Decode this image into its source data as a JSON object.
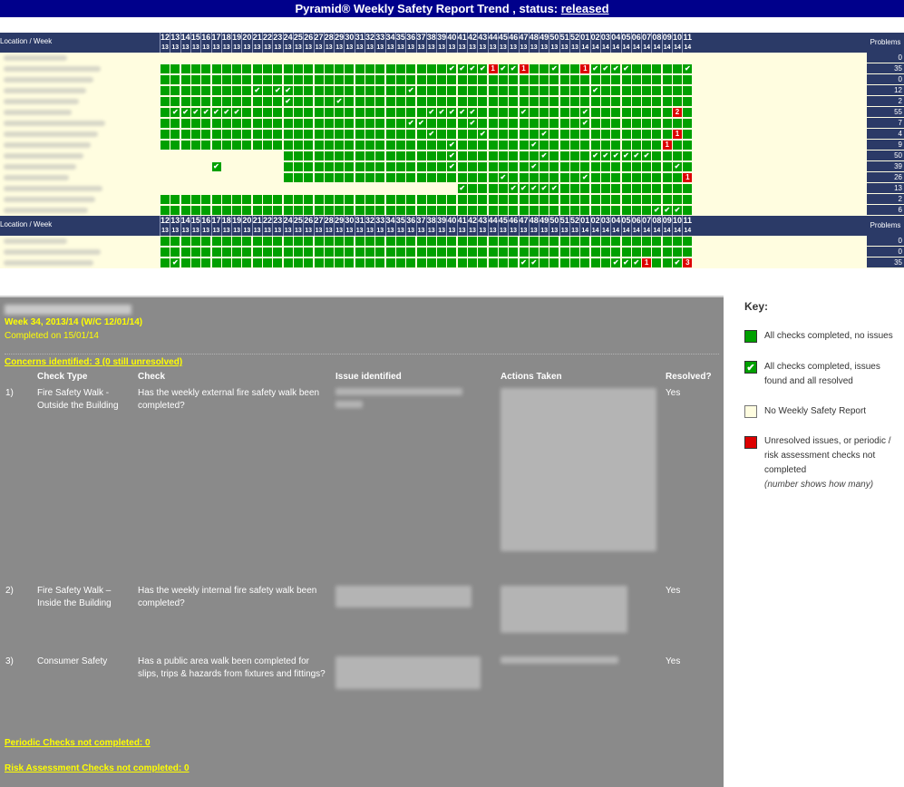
{
  "title": {
    "prefix": "Pyramid® Weekly Safety Report Trend , status: ",
    "status": "released"
  },
  "grid": {
    "header_label": "Location  /  Week",
    "problems_label": "Problems",
    "weeks": [
      {
        "w": "12",
        "y": "13"
      },
      {
        "w": "13",
        "y": "13"
      },
      {
        "w": "14",
        "y": "13"
      },
      {
        "w": "15",
        "y": "13"
      },
      {
        "w": "16",
        "y": "13"
      },
      {
        "w": "17",
        "y": "13"
      },
      {
        "w": "18",
        "y": "13"
      },
      {
        "w": "19",
        "y": "13"
      },
      {
        "w": "20",
        "y": "13"
      },
      {
        "w": "21",
        "y": "13"
      },
      {
        "w": "22",
        "y": "13"
      },
      {
        "w": "23",
        "y": "13"
      },
      {
        "w": "24",
        "y": "13"
      },
      {
        "w": "25",
        "y": "13"
      },
      {
        "w": "26",
        "y": "13"
      },
      {
        "w": "27",
        "y": "13"
      },
      {
        "w": "28",
        "y": "13"
      },
      {
        "w": "29",
        "y": "13"
      },
      {
        "w": "30",
        "y": "13"
      },
      {
        "w": "31",
        "y": "13"
      },
      {
        "w": "32",
        "y": "13"
      },
      {
        "w": "33",
        "y": "13"
      },
      {
        "w": "34",
        "y": "13"
      },
      {
        "w": "35",
        "y": "13"
      },
      {
        "w": "36",
        "y": "13"
      },
      {
        "w": "37",
        "y": "13"
      },
      {
        "w": "38",
        "y": "13"
      },
      {
        "w": "39",
        "y": "13"
      },
      {
        "w": "40",
        "y": "13"
      },
      {
        "w": "41",
        "y": "13"
      },
      {
        "w": "42",
        "y": "13"
      },
      {
        "w": "43",
        "y": "13"
      },
      {
        "w": "44",
        "y": "13"
      },
      {
        "w": "45",
        "y": "13"
      },
      {
        "w": "46",
        "y": "13"
      },
      {
        "w": "47",
        "y": "13"
      },
      {
        "w": "48",
        "y": "13"
      },
      {
        "w": "49",
        "y": "13"
      },
      {
        "w": "50",
        "y": "13"
      },
      {
        "w": "51",
        "y": "13"
      },
      {
        "w": "52",
        "y": "13"
      },
      {
        "w": "01",
        "y": "14"
      },
      {
        "w": "02",
        "y": "14"
      },
      {
        "w": "03",
        "y": "14"
      },
      {
        "w": "04",
        "y": "14"
      },
      {
        "w": "05",
        "y": "14"
      },
      {
        "w": "06",
        "y": "14"
      },
      {
        "w": "07",
        "y": "14"
      },
      {
        "w": "08",
        "y": "14"
      },
      {
        "w": "09",
        "y": "14"
      },
      {
        "w": "10",
        "y": "14"
      },
      {
        "w": "11",
        "y": "14"
      }
    ],
    "sections": [
      {
        "rows": [
          {
            "cells": "                                    ",
            "problems": "0"
          },
          {
            "cells": "GGGGGGGGGGGGGGGGGGGGGGGGGGGGCCCCR1CCR1GGCGGR1CCCCGGGGGCCCGR1R1CG",
            "problems": "35"
          },
          {
            "cells": "GGGGGGGGGGGGGGGGGGGGGGGGGGGGGGGGGGGGGGGGGGGGGGGGGGGG",
            "problems": "0"
          },
          {
            "cells": "GGGGGGGGGCGCCGGGGGGGGGGGCGGGGGGGGGGGGGGGGGCGGGGGGGGGGGGGGGGGGCGG",
            "problems": "12"
          },
          {
            "cells": "GGGGGGGGGGGGCGGGGCGGGGGGGGGGGGGGGGGGGGGGGGGGGGGGGGGG",
            "problems": "2"
          },
          {
            "cells": "GCCCCCCCGGGGGGGGGGGGGGGGGGCCCCCGGGGCGGGGGCGGGGGGGGR2GGGGR1",
            "problems": "55"
          },
          {
            "cells": "GGGGGGGGGGGGGGGGGGGGGGGGCCGGGGCGGGGGGGGGGCGGGGGGGGGGGGGGGR1GG",
            "problems": "7"
          },
          {
            "cells": "GGGGGGGGGGGGGGGGGGGGGGGGGGCGGGGCGGGGGCGGGGGGGGGGGGR1GGGGGGGGGGG",
            "problems": "4"
          },
          {
            "cells": "GGGGGGGGGGGGGGGGGGGGGGGGGGGGCGGGGGGGCGGGGGGGGGGGGR1GGGGGGGGGGG",
            "problems": "9"
          },
          {
            "cells": "____________GGGGGGGGGGGGGGGGCGGGGGGGGCGGGGCCCCCCGGGGGR2R1GGR1R1",
            "problems": "50"
          },
          {
            "cells": "_____C______GGGGGGGGGGGGGGGGCGGGGGGGCGGGGGGGGGGGGGCGGGCGGR5GR2C",
            "problems": "39"
          },
          {
            "cells": "____________GGGGGGGGGGGGGGGGGGGGGCGGGGGGGCGGGGGGGGGR1GGGGGGR1GG",
            "problems": "26"
          },
          {
            "cells": "_____________________________CGGGGCCCCCGGGGGGGGGGGGGGGGGGGGG",
            "problems": "13"
          },
          {
            "cells": "GGGGGGGGGGGGGGGGGGGGGGGGGGGGGGGGGGGGGGGGGGGGGGGGGGGG",
            "problems": "2"
          },
          {
            "cells": "GGGGGGGGGGGGGGGGGGGGGGGGGGGGGGGGGGGGGGGGGGGGGGGGCCCGGG",
            "problems": "6"
          }
        ]
      },
      {
        "rows": [
          {
            "cells": "GGGGGGGGGGGGGGGGGGGGGGGGGGGGGGGGGGGGGGGGGGGGGGGGGGGG",
            "problems": "0"
          },
          {
            "cells": "GGGGGGGGGGGGGGGGGGGGGGGGGGGGGGGGGGGGGGGGGGGGGGGGGGGG",
            "problems": "0"
          },
          {
            "cells": "GCGGGGGGGGGGGGGGGGGGGGGGGGGGGGGGGGGCCGGGGGGGCCCR1GGCR3R1GGCGGG",
            "problems": "35"
          }
        ]
      }
    ]
  },
  "detail": {
    "week": "Week 34, 2013/14 (W/C 12/01/14)",
    "completed": "Completed on 15/01/14",
    "concerns": "Concerns identified: 3  (0 still unresolved)",
    "headers": {
      "check_type": "Check Type",
      "check": "Check",
      "issue": "Issue identified",
      "actions": "Actions Taken",
      "resolved": "Resolved?"
    },
    "items": [
      {
        "num": "1)",
        "type": "Fire Safety Walk - Outside the Building",
        "check": "Has the weekly external fire safety walk been completed?",
        "resolved": "Yes"
      },
      {
        "num": "2)",
        "type": "Fire Safety Walk – Inside the Building",
        "check": "Has the weekly internal fire safety walk been completed?",
        "resolved": "Yes"
      },
      {
        "num": "3)",
        "type": "Consumer Safety",
        "check": "Has a public area walk been completed for slips, trips & hazards from fixtures and fittings?",
        "resolved": "Yes"
      }
    ],
    "periodic": "Periodic Checks not completed: 0",
    "risk": "Risk Assessment Checks not completed: 0"
  },
  "key": {
    "title": "Key:",
    "items": [
      {
        "text": "All checks completed, no issues"
      },
      {
        "text": "All checks completed, issues found and all resolved"
      },
      {
        "text": "No Weekly Safety Report"
      },
      {
        "text": "Unresolved issues, or periodic / risk assessment checks not completed",
        "note": "(number shows how many)"
      }
    ],
    "colors": {
      "green": "#00a000",
      "red": "#dd0000",
      "cream": "#fffde0"
    }
  }
}
